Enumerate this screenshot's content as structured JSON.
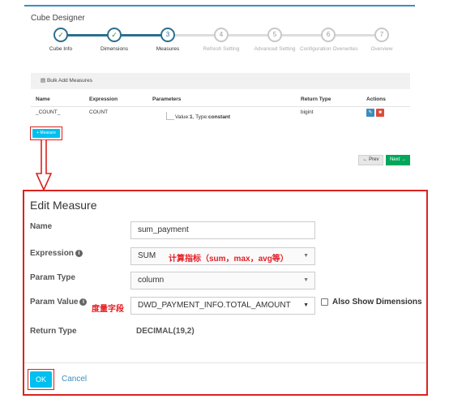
{
  "designer": {
    "title": "Cube Designer"
  },
  "wizard": {
    "steps": [
      {
        "label": "Cube Info",
        "mark": "✓",
        "state": "done"
      },
      {
        "label": "Dimensions",
        "mark": "✓",
        "state": "done"
      },
      {
        "label": "Measures",
        "mark": "3",
        "state": "current"
      },
      {
        "label": "Refresh Setting",
        "mark": "4",
        "state": "pending"
      },
      {
        "label": "Advanced Setting",
        "mark": "5",
        "state": "pending"
      },
      {
        "label": "Configuration Overwrites",
        "mark": "6",
        "state": "pending"
      },
      {
        "label": "Overview",
        "mark": "7",
        "state": "pending"
      }
    ]
  },
  "toolbar": {
    "bulk_add_label": "Bulk Add Measures"
  },
  "measures_table": {
    "headers": {
      "name": "Name",
      "expression": "Expression",
      "parameters": "Parameters",
      "return_type": "Return Type",
      "actions": "Actions"
    },
    "rows": [
      {
        "name": "_COUNT_",
        "expression": "COUNT",
        "param_value_prefix": "Value:",
        "param_value": "1",
        "param_type_prefix": ", Type:",
        "param_type": "constant",
        "return_type": "bigint"
      }
    ]
  },
  "measure_button": {
    "label": "+ Measure"
  },
  "nav": {
    "prev_label": "← Prev",
    "next_label": "Next →"
  },
  "dialog": {
    "title": "Edit Measure",
    "labels": {
      "name": "Name",
      "expression": "Expression",
      "param_type": "Param Type",
      "param_value": "Param Value",
      "return_type": "Return Type"
    },
    "fields": {
      "name_value": "sum_payment",
      "expression_value": "SUM",
      "param_type_value": "column",
      "param_value_value": "DWD_PAYMENT_INFO.TOTAL_AMOUNT",
      "return_type_value": "DECIMAL(19,2)"
    },
    "annotations": {
      "expression_note": "计算指标（sum，max，avg等）",
      "param_value_note": "度量字段"
    },
    "also_show_dimensions": "Also Show Dimensions",
    "ok_label": "OK",
    "cancel_label": "Cancel"
  },
  "colors": {
    "accent": "#3c8dbc",
    "highlight": "#d9231e",
    "button_blue": "#00c0ef",
    "success": "#00a65a",
    "danger": "#dd4b39"
  }
}
